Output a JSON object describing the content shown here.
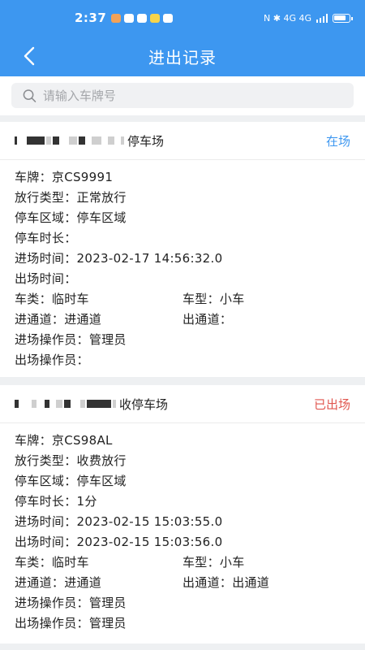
{
  "status_bar": {
    "time": "2:37",
    "notif_colors": [
      "#f3a257",
      "#ffffff",
      "#ffffff",
      "#f7d44a",
      "#ffffff"
    ],
    "sys_text": "N ✱ 4G 4G"
  },
  "page_title": "进出记录",
  "search": {
    "placeholder": "请输入车牌号"
  },
  "records": [
    {
      "lot_name": "停车场",
      "status": "在场",
      "fields": {
        "plate_label": "车牌：",
        "plate": "京CS9991",
        "release_label": "放行类型：",
        "release": "正常放行",
        "area_label": "停车区域：",
        "area": "停车区域",
        "duration_label": "停车时长：",
        "duration": "",
        "entry_time_label": "进场时间：",
        "entry_time": "2023-02-17 14:56:32.0",
        "exit_time_label": "出场时间：",
        "exit_time": "",
        "car_class_label": "车类：",
        "car_class": "临时车",
        "car_type_label": "车型：",
        "car_type": "小车",
        "entry_lane_label": "进通道：",
        "entry_lane": "进通道",
        "exit_lane_label": "出通道：",
        "exit_lane": "",
        "entry_operator_label": "进场操作员：",
        "entry_operator": "管理员",
        "exit_operator_label": "出场操作员：",
        "exit_operator": ""
      }
    },
    {
      "lot_name": "收停车场",
      "status": "已出场",
      "fields": {
        "plate_label": "车牌：",
        "plate": "京CS98AL",
        "release_label": "放行类型：",
        "release": "收费放行",
        "area_label": "停车区域：",
        "area": "停车区域",
        "duration_label": "停车时长：",
        "duration": "1分",
        "entry_time_label": "进场时间：",
        "entry_time": "2023-02-15 15:03:55.0",
        "exit_time_label": "出场时间：",
        "exit_time": "2023-02-15 15:03:56.0",
        "car_class_label": "车类：",
        "car_class": "临时车",
        "car_type_label": "车型：",
        "car_type": "小车",
        "entry_lane_label": "进通道：",
        "entry_lane": "进通道",
        "exit_lane_label": "出通道：",
        "exit_lane": "出通道",
        "entry_operator_label": "进场操作员：",
        "entry_operator": "管理员",
        "exit_operator_label": "出场操作员：",
        "exit_operator": "管理员"
      }
    }
  ]
}
